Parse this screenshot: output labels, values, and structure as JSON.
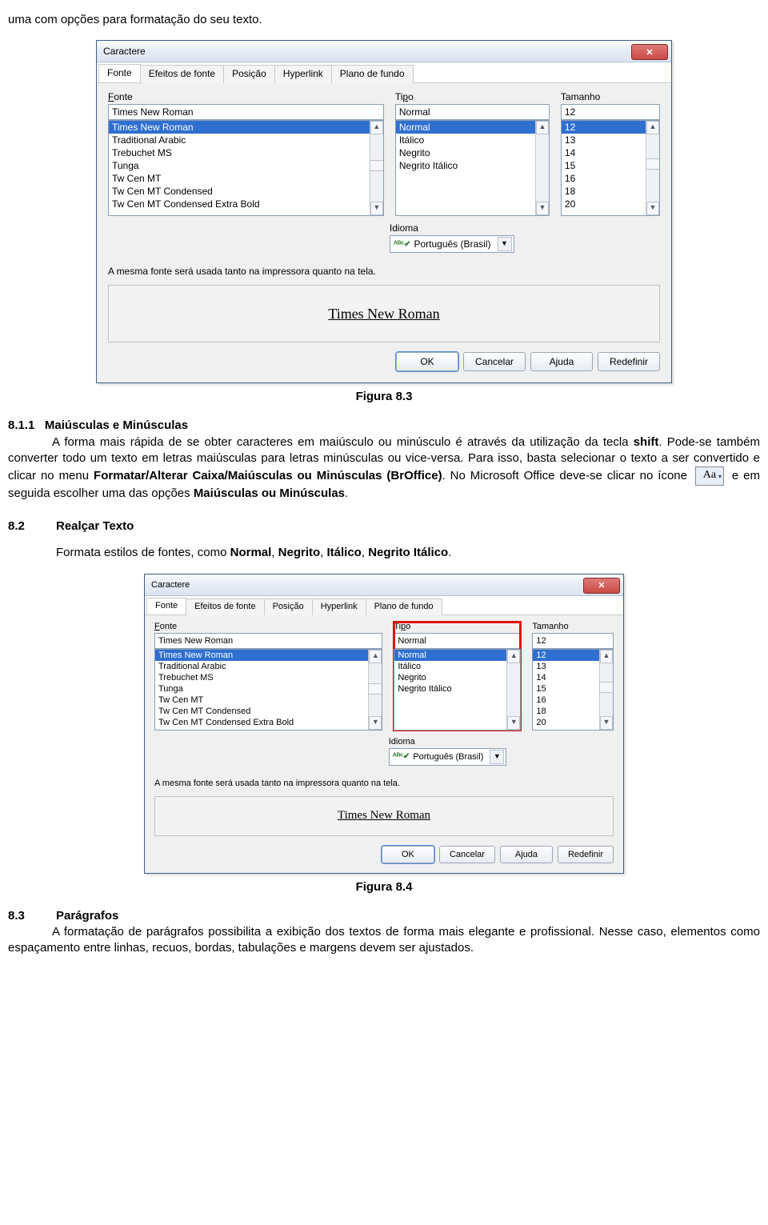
{
  "doc": {
    "intro_line": "uma com opções para formatação do seu texto.",
    "fig83": "Figura 8.3",
    "sec811_num": "8.1.1",
    "sec811_title": "Maiúsculas e Minúsculas",
    "p811_a": "A forma mais rápida de se obter caracteres em maiúsculo ou minúsculo é através da utilização da tecla ",
    "p811_shift": "shift",
    "p811_b": ". Pode-se também converter todo um texto em letras maiúsculas para letras minúsculas ou vice-versa. Para isso, basta selecionar o texto a ser convertido e clicar no menu ",
    "p811_menu": "Formatar/Alterar Caixa/Maiúsculas ou Minúsculas (BrOffice)",
    "p811_c": ". No Microsoft Office deve-se clicar no ícone ",
    "p811_d": " e em seguida escolher uma das opções ",
    "p811_opt": "Maiúsculas ou Minúsculas",
    "p811_e": ".",
    "aa_glyph": "Aa",
    "sec82_num": "8.2",
    "sec82_title": "Realçar Texto",
    "p82_a": "Formata estilos de fontes, como ",
    "p82_n": "Normal",
    "p82_sep1": ", ",
    "p82_b": "Negrito",
    "p82_sep2": ", ",
    "p82_i": "Itálico",
    "p82_sep3": ", ",
    "p82_ni": "Negrito Itálico",
    "p82_end": ".",
    "fig84": "Figura 8.4",
    "sec83_num": "8.3",
    "sec83_title": "Parágrafos",
    "p83": "A formatação de parágrafos possibilita a exibição dos textos de forma mais elegante e profissional. Nesse caso, elementos como espaçamento entre linhas, recuos, bordas, tabulações e margens devem ser  ajustados."
  },
  "dialog": {
    "title": "Caractere",
    "tabs": [
      "Fonte",
      "Efeitos de fonte",
      "Posição",
      "Hyperlink",
      "Plano de fundo"
    ],
    "labels": {
      "fonte": "Fonte",
      "tipo": "Tipo",
      "tam": "Tamanho",
      "idioma": "Idioma"
    },
    "font_value": "Times New Roman",
    "fonts": [
      "Times New Roman",
      "Traditional Arabic",
      "Trebuchet MS",
      "Tunga",
      "Tw Cen MT",
      "Tw Cen MT Condensed",
      "Tw Cen MT Condensed Extra Bold"
    ],
    "tipo_value": "Normal",
    "tipos": [
      "Normal",
      "Itálico",
      "Negrito",
      "Negrito Itálico"
    ],
    "tam_value": "12",
    "tams": [
      "12",
      "13",
      "14",
      "15",
      "16",
      "18",
      "20"
    ],
    "idioma_value": "Português (Brasil)",
    "note": "A mesma fonte será usada tanto na impressora quanto na tela.",
    "preview": "Times New Roman",
    "buttons": {
      "ok": "OK",
      "cancel": "Cancelar",
      "help": "Ajuda",
      "reset": "Redefinir"
    }
  }
}
